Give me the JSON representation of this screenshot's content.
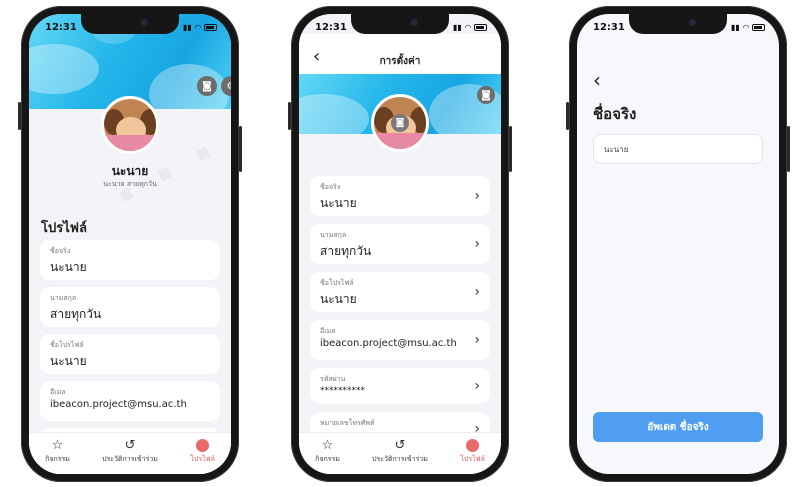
{
  "status_time": "12:31",
  "phone1": {
    "name": "นะนาย",
    "fullname": "นะนาย สายทุกวัน",
    "section_title": "โปรไฟล์",
    "fields": [
      {
        "label": "ชื่อจริง",
        "value": "นะนาย"
      },
      {
        "label": "นามสกุล",
        "value": "สายทุกวัน"
      },
      {
        "label": "ชื่อโปรไฟล์",
        "value": "นะนาย"
      },
      {
        "label": "อีเมล",
        "value": "ibeacon.project@msu.ac.th"
      }
    ]
  },
  "phone2": {
    "title": "การตั้งค่า",
    "fields": [
      {
        "label": "ชื่อจริง",
        "value": "นะนาย"
      },
      {
        "label": "นามสกุล",
        "value": "สายทุกวัน"
      },
      {
        "label": "ชื่อโปรไฟล์",
        "value": "นะนาย"
      },
      {
        "label": "อีเมล",
        "value": "ibeacon.project@msu.ac.th"
      },
      {
        "label": "รหัสผ่าน",
        "value": "**********"
      },
      {
        "label": "หมายเลขโทรศัพท์",
        "value": ""
      }
    ]
  },
  "phone3": {
    "title": "ชื่อจริง",
    "input_value": "นะนาย",
    "button_label": "อัพเดต ชื่อจริง"
  },
  "tabs": [
    {
      "label": "กิจกรรม",
      "icon": "star-icon"
    },
    {
      "label": "ประวัติการเข้าร่วม",
      "icon": "history-icon"
    },
    {
      "label": "โปรไฟล์",
      "icon": "profile-icon"
    }
  ],
  "colors": {
    "accent": "#4f9ef0",
    "active_tab": "#e85d5d",
    "banner": "#1aa8e3"
  }
}
